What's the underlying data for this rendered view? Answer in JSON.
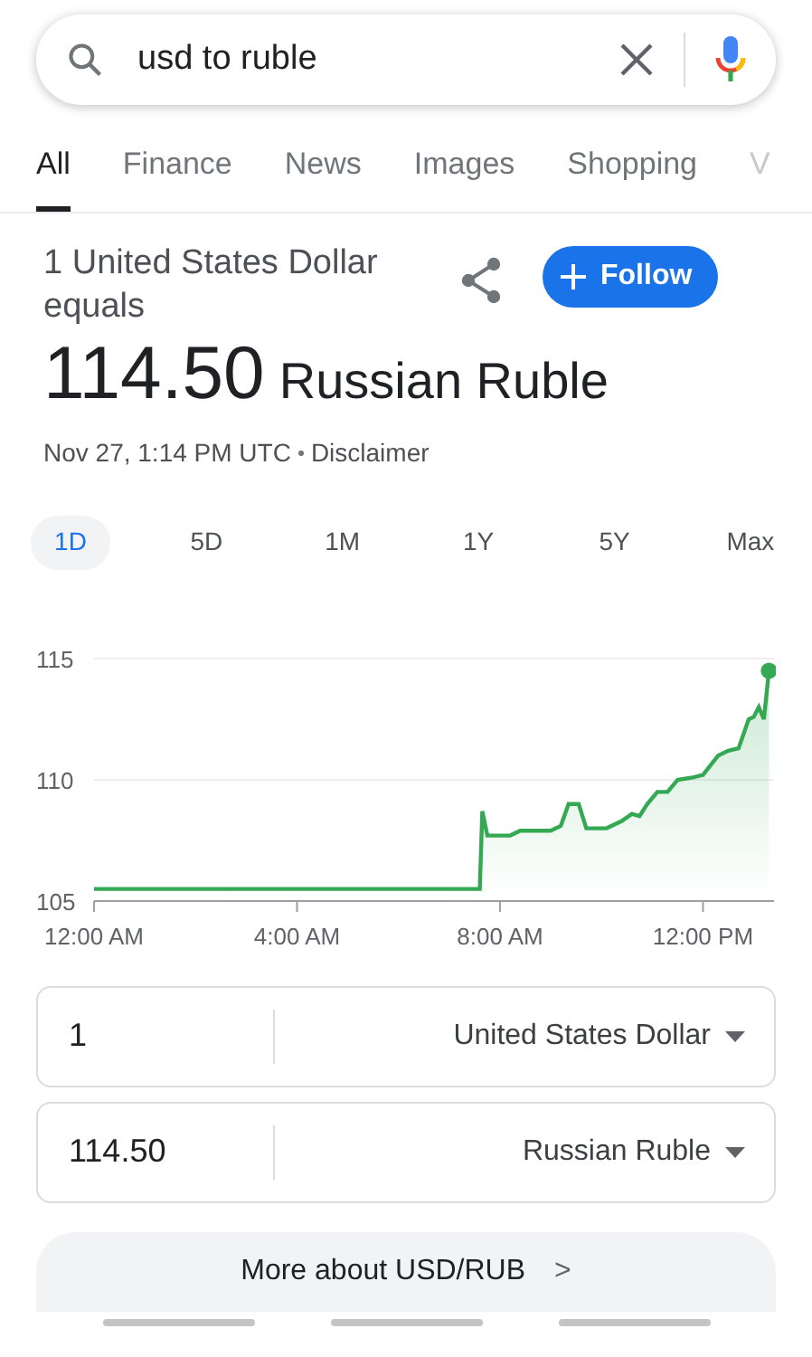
{
  "search": {
    "query": "usd to ruble"
  },
  "tabs": [
    {
      "label": "All",
      "selected": true
    },
    {
      "label": "Finance",
      "selected": false
    },
    {
      "label": "News",
      "selected": false
    },
    {
      "label": "Images",
      "selected": false
    },
    {
      "label": "Shopping",
      "selected": false
    },
    {
      "label": "V",
      "selected": false
    }
  ],
  "header": {
    "from_text": "1 United States Dollar equals",
    "follow_label": "Follow",
    "rate": "114.50",
    "to_currency": "Russian Ruble",
    "timestamp": "Nov 27, 1:14 PM UTC",
    "disclaimer": "Disclaimer"
  },
  "ranges": [
    {
      "label": "1D",
      "selected": true
    },
    {
      "label": "5D",
      "selected": false
    },
    {
      "label": "1M",
      "selected": false
    },
    {
      "label": "1Y",
      "selected": false
    },
    {
      "label": "5Y",
      "selected": false
    },
    {
      "label": "Max",
      "selected": false
    }
  ],
  "chart": {
    "chart_data": {
      "type": "area",
      "x": [
        0,
        7.6,
        7.65,
        7.75,
        8.2,
        8.4,
        9.0,
        9.2,
        9.35,
        9.55,
        9.7,
        10.1,
        10.4,
        10.6,
        10.75,
        10.9,
        11.1,
        11.3,
        11.5,
        11.8,
        12.0,
        12.3,
        12.5,
        12.7,
        12.9,
        13.0,
        13.1,
        13.2,
        13.3
      ],
      "series": [
        {
          "color": "#34a853",
          "values": [
            105.5,
            105.5,
            108.7,
            107.7,
            107.7,
            107.9,
            107.9,
            108.1,
            109.0,
            109.0,
            108.0,
            108.0,
            108.3,
            108.6,
            108.5,
            109.0,
            109.5,
            109.5,
            110.0,
            110.1,
            110.2,
            111.0,
            111.2,
            111.3,
            112.5,
            112.6,
            113.0,
            112.5,
            114.5
          ]
        }
      ],
      "xlim": [
        0,
        13.4
      ],
      "ylim": [
        105,
        115
      ],
      "xticks": [
        {
          "value": 0,
          "label": "12:00 AM"
        },
        {
          "value": 4,
          "label": "4:00 AM"
        },
        {
          "value": 8,
          "label": "8:00 AM"
        },
        {
          "value": 12,
          "label": "12:00 PM"
        }
      ],
      "yticks": [
        105,
        110,
        115
      ]
    }
  },
  "converter": [
    {
      "amount": "1",
      "currency": "United States Dollar"
    },
    {
      "amount": "114.50",
      "currency": "Russian Ruble"
    }
  ],
  "more_button": {
    "label": "More about USD/RUB",
    "chevron": ">"
  }
}
